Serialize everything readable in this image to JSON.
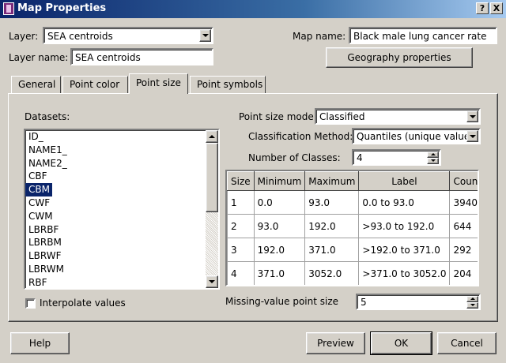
{
  "window": {
    "title": "Map Properties",
    "help_btn": "?",
    "close_btn": "X"
  },
  "layer": {
    "label": "Layer:",
    "value": "SEA centroids"
  },
  "layer_name": {
    "label": "Layer name:",
    "value": "SEA centroids"
  },
  "map_name": {
    "label": "Map name:",
    "value": "Black male lung cancer rate"
  },
  "geography_button": "Geography properties",
  "tabs": [
    {
      "label": "General"
    },
    {
      "label": "Point color"
    },
    {
      "label": "Point size"
    },
    {
      "label": "Point symbols"
    }
  ],
  "active_tab": "Point size",
  "datasets": {
    "label": "Datasets:",
    "items": [
      "ID_",
      "NAME1_",
      "NAME2_",
      "CBF",
      "CBM",
      "CWF",
      "CWM",
      "LBRBF",
      "LBRBM",
      "LBRWF",
      "LBRWM",
      "RBF"
    ],
    "selected": "CBM"
  },
  "point_size_mode": {
    "label": "Point size mode",
    "value": "Classified"
  },
  "classification_method": {
    "label": "Classification Method:",
    "value": "Quantiles (unique values"
  },
  "number_of_classes": {
    "label": "Number of Classes:",
    "value": "4"
  },
  "class_table": {
    "headers": [
      "Size",
      "Minimum",
      "Maximum",
      "Label",
      "Count"
    ],
    "rows": [
      [
        "1",
        "0.0",
        "93.0",
        "0.0 to 93.0",
        "3940"
      ],
      [
        "2",
        "93.0",
        "192.0",
        ">93.0 to 192.0",
        "644"
      ],
      [
        "3",
        "192.0",
        "371.0",
        ">192.0 to 371.0",
        "292"
      ],
      [
        "4",
        "371.0",
        "3052.0",
        ">371.0 to 3052.0",
        "204"
      ]
    ]
  },
  "interpolate": {
    "label": "Interpolate values",
    "checked": false
  },
  "missing_value": {
    "label": "Missing-value point size",
    "value": "5"
  },
  "buttons": {
    "help": "Help",
    "preview": "Preview",
    "ok": "OK",
    "cancel": "Cancel"
  }
}
